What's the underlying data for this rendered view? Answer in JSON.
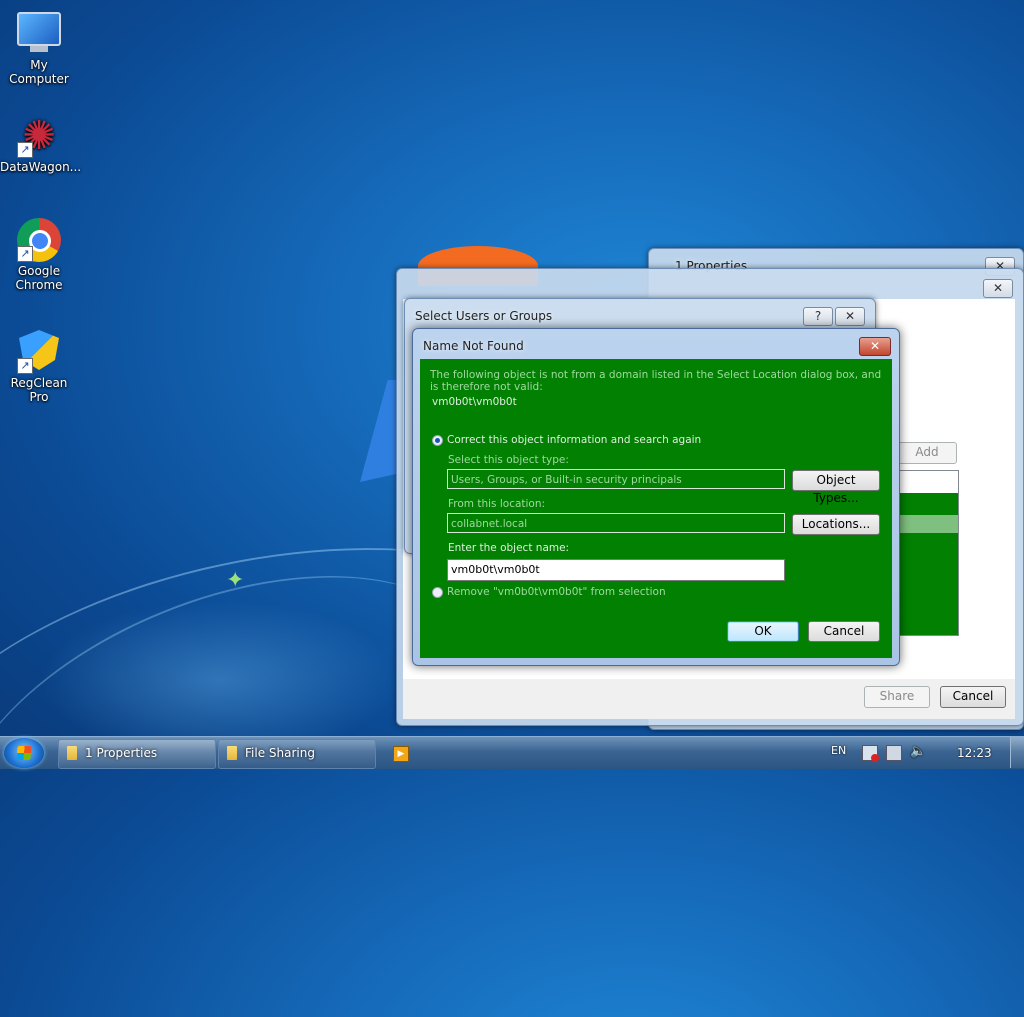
{
  "desktop": {
    "icons": [
      {
        "label": "My Computer",
        "icon": "computer-icon"
      },
      {
        "label": "DataWagon...",
        "icon": "datawagon-icon"
      },
      {
        "label": "Google Chrome",
        "icon": "chrome-icon"
      },
      {
        "label": "RegClean Pro",
        "icon": "regclean-icon"
      }
    ]
  },
  "properties_window": {
    "title": "1 Properties",
    "close_glyph": "✕",
    "add_label": "Add",
    "share_label": "Share",
    "cancel_label": "Cancel"
  },
  "select_dialog": {
    "title": "Select Users or Groups",
    "help_glyph": "?",
    "close_glyph": "✕"
  },
  "name_not_found": {
    "title": "Name Not Found",
    "close_glyph": "✕",
    "message": "The following object is not from a domain listed in the Select Location dialog box, and is therefore not valid:",
    "object": "vm0b0t\\vm0b0t",
    "option_correct": "Correct this object information and search again",
    "label_object_type": "Select this object type:",
    "value_object_type": "Users, Groups, or Built-in security principals",
    "object_types_button": "Object Types...",
    "label_location": "From this location:",
    "value_location": "collabnet.local",
    "locations_button": "Locations...",
    "label_object_name": "Enter the object name:",
    "value_object_name": "vm0b0t\\vm0b0t",
    "option_remove": "Remove \"vm0b0t\\vm0b0t\" from selection",
    "ok_label": "OK",
    "cancel_label": "Cancel",
    "selected_option": "correct"
  },
  "taskbar": {
    "buttons": [
      {
        "label": "1 Properties",
        "icon": "folder-icon"
      },
      {
        "label": "File Sharing",
        "icon": "folder-icon"
      }
    ],
    "language": "EN",
    "time": "12:23"
  },
  "colors": {
    "dialog_body": "#018001",
    "desktop_blue": "#1569b8"
  }
}
